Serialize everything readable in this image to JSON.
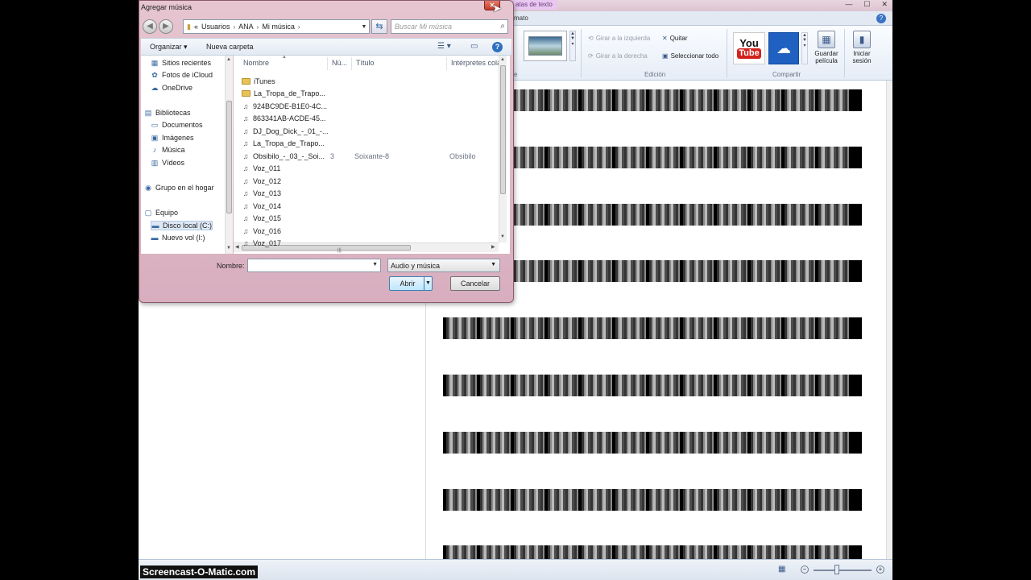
{
  "watermark": "Screencast-O-Matic.com",
  "moviemaker": {
    "context_tab": "Herramientas de texto",
    "context_tab_visible": "atas de texto",
    "format_tab": "mato",
    "window_buttons": {
      "minimize": "—",
      "maximize": "☐",
      "close": "✕"
    },
    "help": "?",
    "ribbon": {
      "rotate_left": "Girar a la izquierda",
      "rotate_right": "Girar a la derecha",
      "remove": "Quitar",
      "select_all": "Seleccionar todo",
      "group_edit": "Edición",
      "group_share": "Compartir",
      "group_partial": "e",
      "youtube_you": "You",
      "youtube_tube": "Tube",
      "save_movie": "Guardar película",
      "sign_in": "Iniciar sesión"
    },
    "storyboard_strip_count": 9,
    "zoom": {
      "minus": "−",
      "plus": "+"
    }
  },
  "dialog": {
    "title": "Agregar música",
    "close": "✕",
    "nav_back": "◀",
    "nav_forward": "▶",
    "address": {
      "prefix": "«",
      "parts": [
        "Usuarios",
        "ANA",
        "Mi música"
      ],
      "sep": "›"
    },
    "search_placeholder": "Buscar Mi música",
    "toolbar": {
      "organize": "Organizar ▾",
      "new_folder": "Nueva carpeta",
      "help": "?"
    },
    "nav_pane": [
      {
        "label": "Sitios recientes",
        "icon": "recent-places-icon",
        "glyph": "▦"
      },
      {
        "label": "Fotos de iCloud",
        "icon": "icloud-photos-icon",
        "glyph": "✿"
      },
      {
        "label": "OneDrive",
        "icon": "onedrive-icon",
        "glyph": "☁"
      },
      {
        "label": "Bibliotecas",
        "icon": "libraries-icon",
        "glyph": "▤"
      },
      {
        "label": "Documentos",
        "icon": "documents-icon",
        "glyph": "▭"
      },
      {
        "label": "Imágenes",
        "icon": "images-icon",
        "glyph": "▣"
      },
      {
        "label": "Música",
        "icon": "music-icon",
        "glyph": "♪"
      },
      {
        "label": "Vídeos",
        "icon": "videos-icon",
        "glyph": "▥"
      },
      {
        "label": "Grupo en el hogar",
        "icon": "homegroup-icon",
        "glyph": "◉"
      },
      {
        "label": "Equipo",
        "icon": "computer-icon",
        "glyph": "▢"
      },
      {
        "label": "Disco local (C:)",
        "icon": "local-disk-icon",
        "glyph": "▬"
      },
      {
        "label": "Nuevo vol (I:)",
        "icon": "drive-icon",
        "glyph": "▬"
      }
    ],
    "columns": {
      "name": "Nombre",
      "num": "Nú...",
      "title": "Título",
      "artists": "Intérpretes cola..."
    },
    "files": [
      {
        "name": "iTunes",
        "type": "folder",
        "num": "",
        "title": "",
        "artist": ""
      },
      {
        "name": "La_Tropa_de_Trapo...",
        "type": "folder",
        "num": "",
        "title": "",
        "artist": ""
      },
      {
        "name": "924BC9DE-B1E0-4C...",
        "type": "audio",
        "num": "",
        "title": "",
        "artist": ""
      },
      {
        "name": "863341AB-ACDE-45...",
        "type": "audio",
        "num": "",
        "title": "",
        "artist": ""
      },
      {
        "name": "DJ_Dog_Dick_-_01_-...",
        "type": "audio",
        "num": "",
        "title": "",
        "artist": ""
      },
      {
        "name": "La_Tropa_de_Trapo...",
        "type": "audio",
        "num": "",
        "title": "",
        "artist": ""
      },
      {
        "name": "Obsibilo_-_03_-_Soi...",
        "type": "audio",
        "num": "3",
        "title": "Soixante-8",
        "artist": "Obsibilo"
      },
      {
        "name": "Voz_011",
        "type": "audio",
        "num": "",
        "title": "",
        "artist": ""
      },
      {
        "name": "Voz_012",
        "type": "audio",
        "num": "",
        "title": "",
        "artist": ""
      },
      {
        "name": "Voz_013",
        "type": "audio",
        "num": "",
        "title": "",
        "artist": ""
      },
      {
        "name": "Voz_014",
        "type": "audio",
        "num": "",
        "title": "",
        "artist": ""
      },
      {
        "name": "Voz_015",
        "type": "audio",
        "num": "",
        "title": "",
        "artist": ""
      },
      {
        "name": "Voz_016",
        "type": "audio",
        "num": "",
        "title": "",
        "artist": ""
      },
      {
        "name": "Voz_017",
        "type": "audio",
        "num": "",
        "title": "",
        "artist": ""
      }
    ],
    "name_label": "Nombre:",
    "name_value": "",
    "filter_value": "Audio y música",
    "open_label": "Abrir",
    "cancel_label": "Cancelar"
  }
}
